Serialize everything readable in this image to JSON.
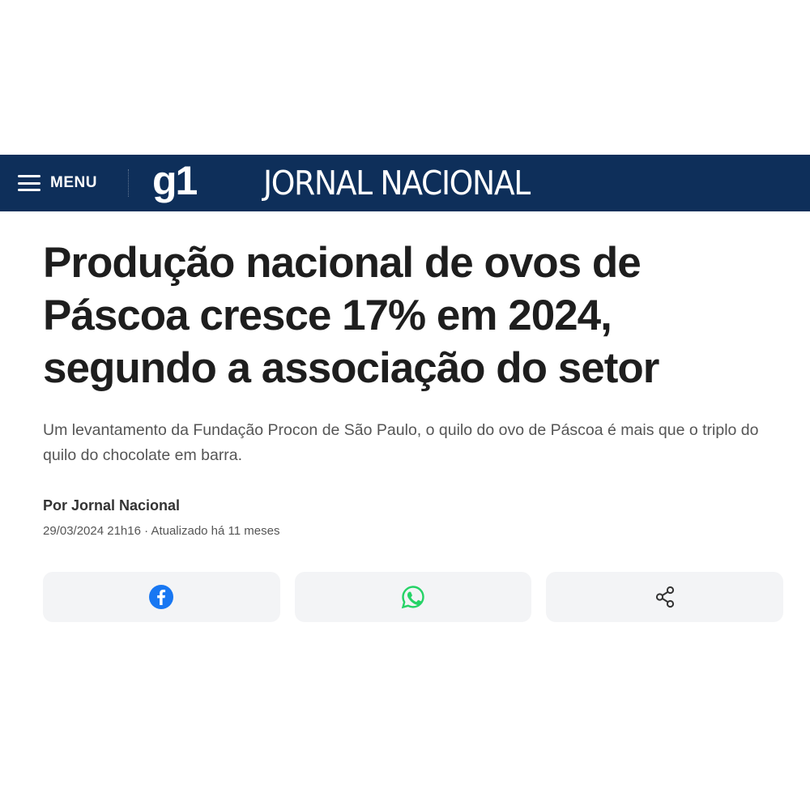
{
  "header": {
    "menu_label": "MENU",
    "logo_text": "g1",
    "section_title": "JORNAL NACIONAL",
    "background_color": "#0e2f5a"
  },
  "article": {
    "headline": "Produção nacional de ovos de Páscoa cresce 17% em 2024, segundo a associação do setor",
    "subtitle": "Um levantamento da Fundação Procon de São Paulo, o quilo do ovo de Páscoa é mais que o triplo do quilo do chocolate em barra.",
    "byline": "Por Jornal Nacional",
    "dateline": "29/03/2024 21h16 · Atualizado há 11 meses"
  },
  "share": {
    "buttons": [
      {
        "icon": "facebook-icon",
        "color": "#1877f2"
      },
      {
        "icon": "whatsapp-icon",
        "color": "#25d366"
      },
      {
        "icon": "share-icon",
        "color": "#333333"
      }
    ]
  }
}
